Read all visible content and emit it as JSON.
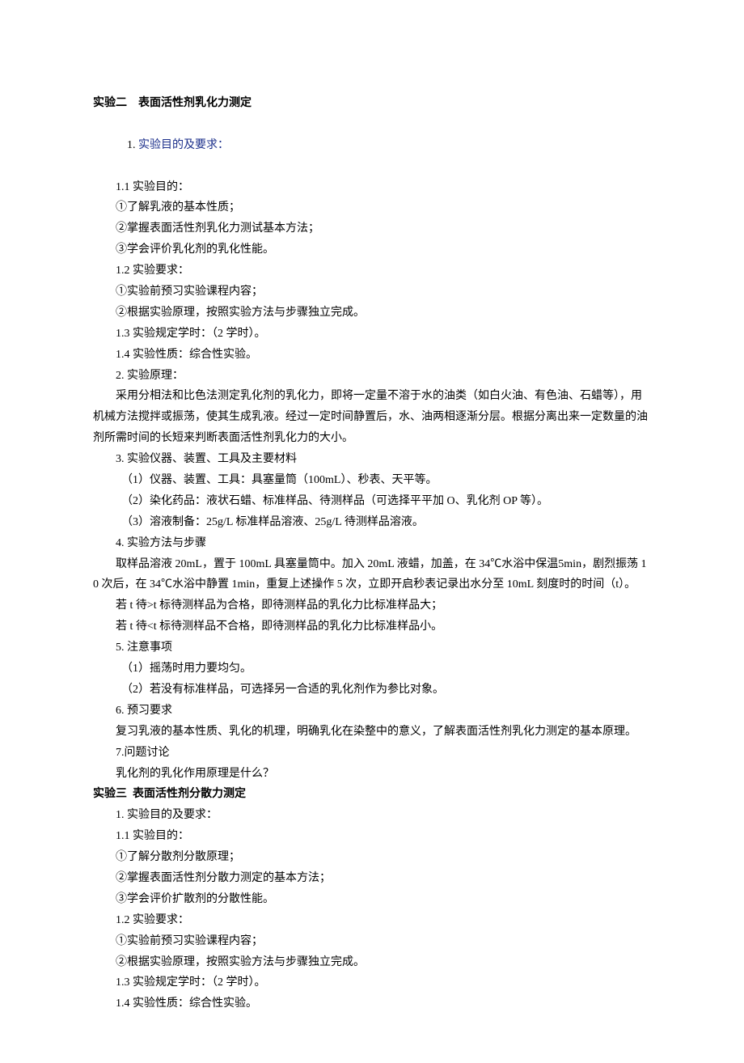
{
  "exp2": {
    "title": "实验二    表面活性剂乳化力测定",
    "s1": {
      "num": "1. ",
      "title": "实验目的及要求：",
      "sub11": "1.1 实验目的：",
      "p1": "①了解乳液的基本性质；",
      "p2": "②掌握表面活性剂乳化力测试基本方法；",
      "p3": "③学会评价乳化剂的乳化性能。",
      "sub12": "1.2 实验要求：",
      "p4": "①实验前预习实验课程内容；",
      "p5": "②根据实验原理，按照实验方法与步骤独立完成。",
      "sub13": "1.3 实验规定学时：（2 学时）。",
      "sub14": "1.4 实验性质：综合性实验。"
    },
    "s2": {
      "title": "2. 实验原理：",
      "p1": "采用分相法和比色法测定乳化剂的乳化力，即将一定量不溶于水的油类（如白火油、有色油、石蜡等），用机械方法搅拌或振荡，使其生成乳液。经过一定时间静置后，水、油两相逐渐分层。根据分离出来一定数量的油剂所需时间的长短来判断表面活性剂乳化力的大小。"
    },
    "s3": {
      "title": "3. 实验仪器、装置、工具及主要材料",
      "p1": "（1）仪器、装置、工具：具塞量筒（100mL）、秒表、天平等。",
      "p2": "（2）染化药品：液状石蜡、标准样品、待测样品（可选择平平加 O、乳化剂 OP 等）。",
      "p3": "（3）溶液制备：25g/L 标准样品溶液、25g/L 待测样品溶液。"
    },
    "s4": {
      "title": "4. 实验方法与步骤",
      "p1": "取样品溶液 20mL，置于 100mL 具塞量筒中。加入 20mL 液蜡，加盖，在 34℃水浴中保温5min，剧烈振荡 10 次后，在 34℃水浴中静置 1min，重复上述操作 5 次，立即开启秒表记录出水分至 10mL 刻度时的时间（t）。",
      "p2": "若 t 待>t 标待测样品为合格，即待测样品的乳化力比标准样品大；",
      "p3": "若 t 待<t 标待测样品不合格，即待测样品的乳化力比标准样品小。"
    },
    "s5": {
      "title": "5. 注意事项",
      "p1": "（1）摇荡时用力要均匀。",
      "p2": "（2）若没有标准样品，可选择另一合适的乳化剂作为参比对象。"
    },
    "s6": {
      "title": "6. 预习要求",
      "p1": "复习乳液的基本性质、乳化的机理，明确乳化在染整中的意义，了解表面活性剂乳化力测定的基本原理。"
    },
    "s7": {
      "title": "7.问题讨论",
      "p1": "乳化剂的乳化作用原理是什么？"
    }
  },
  "exp3": {
    "title": "实验三  表面活性剂分散力测定",
    "s1": {
      "title": "1. 实验目的及要求：",
      "sub11": "1.1 实验目的：",
      "p1": "①了解分散剂分散原理；",
      "p2": "②掌握表面活性剂分散力测定的基本方法；",
      "p3": "③学会评价扩散剂的分散性能。",
      "sub12": "1.2 实验要求：",
      "p4": "①实验前预习实验课程内容；",
      "p5": "②根据实验原理，按照实验方法与步骤独立完成。",
      "sub13": "1.3 实验规定学时：（2 学时）。",
      "sub14": "1.4 实验性质：综合性实验。"
    }
  }
}
